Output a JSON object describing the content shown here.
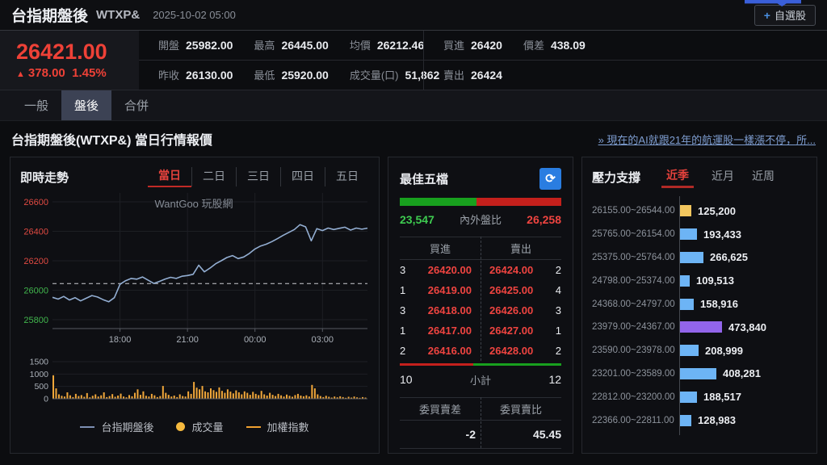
{
  "colors": {
    "up_red": "#ee4137",
    "down_green": "#3ecb50",
    "bar_blue": "#6db4f5",
    "bar_yellow": "#f2c65e",
    "bar_purple": "#9265ea",
    "volume_orange": "#f1a73a",
    "line_blue": "#93aed2",
    "accent_blue": "#2a7de1"
  },
  "header": {
    "title": "台指期盤後",
    "symbol": "WTXP&",
    "datetime": "2025-10-02 05:00",
    "watchlist_button": "自選股",
    "price": "26421.00",
    "change_arrow": "▲",
    "change": "378.00",
    "change_pct": "1.45%",
    "stats_row1": [
      {
        "label": "開盤",
        "value": "25982.00"
      },
      {
        "label": "最高",
        "value": "26445.00"
      },
      {
        "label": "均價",
        "value": "26212.46"
      }
    ],
    "stats_row2": [
      {
        "label": "昨收",
        "value": "26130.00"
      },
      {
        "label": "最低",
        "value": "25920.00"
      },
      {
        "label": "成交量(口)",
        "value": "51,862"
      }
    ],
    "quote_row1": [
      {
        "label": "買進",
        "value": "26420"
      },
      {
        "label": "價差",
        "value": "438.09"
      }
    ],
    "quote_row2": [
      {
        "label": "賣出",
        "value": "26424"
      }
    ]
  },
  "tabs": [
    {
      "label": "一般",
      "active": false
    },
    {
      "label": "盤後",
      "active": true
    },
    {
      "label": "合併",
      "active": false
    }
  ],
  "section": {
    "title": "台指期盤後(WTXP&) 當日行情報價",
    "news_link": "» 現在的AI就跟21年的航運股一樣漲不停，所..."
  },
  "chart_panel": {
    "title": "即時走勢",
    "period_tabs": [
      {
        "label": "當日",
        "active": true
      },
      {
        "label": "二日",
        "active": false
      },
      {
        "label": "三日",
        "active": false
      },
      {
        "label": "四日",
        "active": false
      },
      {
        "label": "五日",
        "active": false
      }
    ],
    "watermark": "WantGoo 玩股網",
    "legend": [
      {
        "label": "台指期盤後",
        "type": "line",
        "color": "#7d8fb3"
      },
      {
        "label": "成交量",
        "type": "dot",
        "color": "#f5b93e"
      },
      {
        "label": "加權指數",
        "type": "line",
        "color": "#f0a030"
      }
    ]
  },
  "chart_data": [
    {
      "type": "line",
      "title": "即時走勢(當日)",
      "x_start": "15:00",
      "x_end": "05:00",
      "x_ticks": [
        "18:00",
        "21:00",
        "00:00",
        "03:00"
      ],
      "y_ticks": [
        26600,
        26400,
        26200,
        26000,
        25800
      ],
      "y_range": [
        25740,
        26660
      ],
      "ref_line": 26045,
      "grid": true,
      "series": [
        {
          "name": "台指期盤後",
          "color": "#93aed2",
          "values": [
            25952,
            25940,
            25958,
            25934,
            25950,
            25928,
            25946,
            25964,
            25954,
            25936,
            25922,
            25950,
            26040,
            26065,
            26080,
            26075,
            26090,
            26068,
            26046,
            26060,
            26075,
            26088,
            26080,
            26095,
            26100,
            26108,
            26170,
            26125,
            26150,
            26180,
            26200,
            26222,
            26235,
            26215,
            26226,
            26250,
            26280,
            26300,
            26312,
            26330,
            26350,
            26372,
            26392,
            26412,
            26445,
            26430,
            26335,
            26418,
            26405,
            26422,
            26412,
            26420,
            26428,
            26408,
            26422,
            26414,
            26421
          ]
        }
      ]
    },
    {
      "type": "bar",
      "title": "成交量",
      "ylabel": "成交量",
      "y_ticks": [
        1500,
        1000,
        500,
        0
      ],
      "y_range": [
        0,
        1500
      ],
      "color": "#f1a73a",
      "values": [
        950,
        420,
        180,
        120,
        90,
        260,
        140,
        70,
        200,
        110,
        150,
        80,
        230,
        60,
        120,
        180,
        90,
        140,
        260,
        70,
        110,
        190,
        80,
        130,
        210,
        90,
        60,
        150,
        100,
        240,
        380,
        160,
        300,
        120,
        90,
        200,
        140,
        70,
        110,
        520,
        240,
        160,
        90,
        130,
        70,
        180,
        110,
        90,
        300,
        200,
        680,
        450,
        380,
        520,
        300,
        260,
        420,
        350,
        280,
        460,
        320,
        240,
        380,
        290,
        220,
        340,
        260,
        180,
        300,
        240,
        160,
        280,
        200,
        150,
        320,
        180,
        130,
        240,
        160,
        110,
        200,
        140,
        90,
        170,
        120,
        80,
        150,
        200,
        130,
        100,
        140,
        90,
        560,
        420,
        180,
        110,
        70,
        120,
        80,
        50,
        90,
        60,
        100,
        70,
        40,
        80,
        50,
        90,
        60,
        40,
        70,
        50
      ]
    },
    {
      "type": "bar",
      "title": "壓力支撐(近季)",
      "orientation": "horizontal",
      "categories": [
        "26155.00~26544.00",
        "25765.00~26154.00",
        "25375.00~25764.00",
        "24798.00~25374.00",
        "24368.00~24797.00",
        "23979.00~24367.00",
        "23590.00~23978.00",
        "23201.00~23589.00",
        "22812.00~23200.00",
        "22366.00~22811.00"
      ],
      "values": [
        125200,
        193433,
        266625,
        109513,
        158916,
        473840,
        208999,
        408281,
        188517,
        128983
      ],
      "display_values": [
        "125,200",
        "193,433",
        "266,625",
        "109,513",
        "158,916",
        "473,840",
        "208,999",
        "408,281",
        "188,517",
        "128,983"
      ],
      "bar_colors": [
        "#f2c65e",
        "#6db4f5",
        "#6db4f5",
        "#6db4f5",
        "#6db4f5",
        "#9265ea",
        "#6db4f5",
        "#6db4f5",
        "#6db4f5",
        "#6db4f5"
      ],
      "max": 473840
    }
  ],
  "best5": {
    "title": "最佳五檔",
    "refresh_icon": "⟳",
    "inner_outer": {
      "buy": "23,547",
      "label": "內外盤比",
      "sell": "26,258",
      "buy_ratio": 0.473
    },
    "col_buy": "買進",
    "col_sell": "賣出",
    "rows": [
      {
        "bvol": "3",
        "bprice": "26420.00",
        "sprice": "26424.00",
        "svol": "2"
      },
      {
        "bvol": "1",
        "bprice": "26419.00",
        "sprice": "26425.00",
        "svol": "4"
      },
      {
        "bvol": "3",
        "bprice": "26418.00",
        "sprice": "26426.00",
        "svol": "3"
      },
      {
        "bvol": "1",
        "bprice": "26417.00",
        "sprice": "26427.00",
        "svol": "1"
      },
      {
        "bvol": "2",
        "bprice": "26416.00",
        "sprice": "26428.00",
        "svol": "2"
      }
    ],
    "subtotal": {
      "left": "10",
      "label": "小計",
      "right": "12",
      "red_ratio": 0.455
    },
    "diff_label": "委買賣差",
    "ratio_label": "委買賣比",
    "diff_value": "-2",
    "ratio_value": "45.45"
  },
  "pressure": {
    "title": "壓力支撐",
    "tabs": [
      {
        "label": "近季",
        "active": true
      },
      {
        "label": "近月",
        "active": false
      },
      {
        "label": "近周",
        "active": false
      }
    ]
  }
}
